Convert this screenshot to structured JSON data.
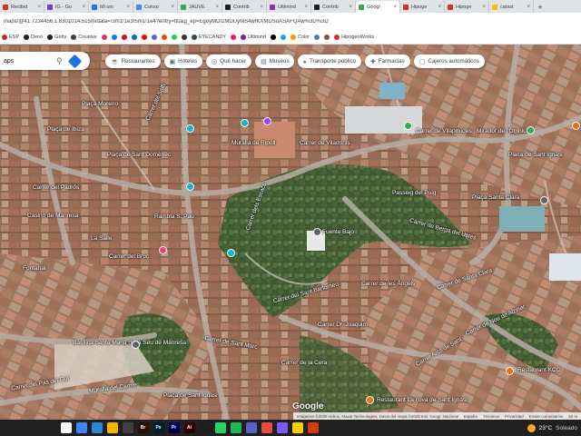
{
  "browser": {
    "tabs": [
      {
        "label": "Recibid",
        "fav": "#d93025"
      },
      {
        "label": "IG - Gu",
        "fav": "#6f42c1"
      },
      {
        "label": "Mi uni",
        "fav": "#1a73e8"
      },
      {
        "label": "Conso",
        "fav": "#4285f4"
      },
      {
        "label": "JAUVE",
        "fav": "#34a853"
      },
      {
        "label": "Contrib",
        "fav": "#202124"
      },
      {
        "label": "Ultimind",
        "fav": "#9c27b0"
      },
      {
        "label": "Contrib",
        "fav": "#202124"
      },
      {
        "label": "Googl",
        "fav": "#34a853",
        "active": true
      },
      {
        "label": "Hipoge",
        "fav": "#d93025"
      },
      {
        "label": "Hipoge",
        "fav": "#d93025"
      },
      {
        "label": "catast",
        "fav": "#fbbc04"
      }
    ],
    "new_tab": "+",
    "url": "maps/@41.7234456,1.8301014,515m/data=!3m1!1e3!5m1!1e4?entry=ttu&g_ep=EgoyMDI1MDUyMS4wIKXMDSoASAFQAw%3D%3D",
    "bookmarks": [
      {
        "label": "ESP",
        "color": "#c62828"
      },
      {
        "label": "Deno",
        "color": "#212121"
      },
      {
        "label": "Getty",
        "color": "#212121"
      },
      {
        "label": "Creative",
        "color": "#424242"
      },
      {
        "label": "",
        "color": "#e1306c"
      },
      {
        "label": "",
        "color": "#1877f2"
      },
      {
        "label": "",
        "color": "#e60023"
      },
      {
        "label": "",
        "color": "#0a66c2"
      },
      {
        "label": "",
        "color": "#ff0000"
      },
      {
        "label": "",
        "color": "#5865f2"
      },
      {
        "label": "",
        "color": "#ff4500"
      },
      {
        "label": "",
        "color": "#25d366"
      },
      {
        "label": "",
        "color": "#333333"
      },
      {
        "label": "EYECANDY",
        "color": "#37474f"
      },
      {
        "label": "",
        "color": "#e91e63"
      },
      {
        "label": "Ultimind",
        "color": "#7b1fa2"
      },
      {
        "label": "",
        "color": "#000000"
      },
      {
        "label": "",
        "color": "#1da1f2"
      },
      {
        "label": "Color",
        "color": "#ff9800"
      },
      {
        "label": "",
        "color": "#607d8b"
      },
      {
        "label": "",
        "color": "#795548"
      },
      {
        "label": "HipogeoWorks",
        "color": "#d32f2f"
      }
    ]
  },
  "maps": {
    "search_value": "aps",
    "search_icon": "search-icon",
    "directions_icon": "directions-icon",
    "chips": [
      {
        "label": "Restaurantes",
        "glyph": "☕"
      },
      {
        "label": "Hoteles",
        "glyph": "▣"
      },
      {
        "label": "Qué hacer",
        "glyph": "◎"
      },
      {
        "label": "Museos",
        "glyph": "▤"
      },
      {
        "label": "Transporte público",
        "glyph": "▸"
      },
      {
        "label": "Farmacias",
        "glyph": "✚"
      },
      {
        "label": "Cajeros automáticos",
        "glyph": "▢"
      }
    ],
    "labels": {
      "l1": "Plaça Moreno",
      "l2": "Plaça de Ibiza",
      "l3": "Carrer de Vilaproïdes",
      "l4": "Carrer de Viladrinis",
      "l5": "Muralla de Ripoll",
      "l6": "Carrer del Padrós",
      "l7": "Carrer dels Escacs",
      "l8": "Passeig del Puig",
      "l9": "Fuente Bajo",
      "l10": "La Salle",
      "l11": "Rambla S. Pau",
      "l12": "Carrer del Sant Bartomeu",
      "l13": "Carrer de Berga del Ustes",
      "l14": "Basílica Santa Maria de la Seu de Manresa",
      "l15": "Carrer de la Cera",
      "l16": "Plaça de Sant Ignasi",
      "l17": "Restaurant La cova de Sant Ignasi",
      "l18": "Restaurant KCC",
      "l19": "Fontanal",
      "l20": "Muralla del Carme",
      "l21": "Plaça Santa Clara",
      "l22": "Carrer de les Àngels",
      "l23": "Carrer del Salfí",
      "l24": "Casino de Manresa",
      "l25": "Carrer de Santa Clara",
      "l26": "Plaça de Sant Domènec",
      "l27": "Carrer del Pas del Gol",
      "l28": "Carrer de Sant Marc",
      "l29": "Carrer Arcs de Sant",
      "l30": "Mirador de l'Òmnium",
      "l31": "Placa de Sant Ignasi",
      "l32": "Carrer Dr. Joaquim",
      "l33": "Carrer de Nou de Alzinar",
      "l34": "Carrer del Bruc"
    },
    "google_logo": "Google",
    "attribution": [
      "Imágenes ©2025 Airbus, Maxar Technologies, Datos del mapa ©2025 Inst. Geogr. Nacional",
      "España",
      "Términos",
      "Privacidad",
      "Enviar comentarios",
      "50 m"
    ]
  },
  "taskbar": {
    "apps": [
      {
        "label": "",
        "color": "#ffffff"
      },
      {
        "label": "",
        "color": "#3a86ff"
      },
      {
        "label": "",
        "color": "#2b88d8"
      },
      {
        "label": "",
        "color": "#f4b400"
      },
      {
        "label": "",
        "color": "#404040"
      },
      {
        "label": "Br",
        "color": "#2a1000"
      },
      {
        "label": "Ps",
        "color": "#001e36"
      },
      {
        "label": "Pr",
        "color": "#00005b"
      },
      {
        "label": "Ai",
        "color": "#330000"
      },
      {
        "label": "",
        "color": "#1e1e1e"
      },
      {
        "label": "",
        "color": "#25d366"
      },
      {
        "label": "",
        "color": "#1db954"
      },
      {
        "label": "",
        "color": "#5b5fc7"
      },
      {
        "label": "",
        "color": "#e94b3c"
      },
      {
        "label": "",
        "color": "#7a5af8"
      },
      {
        "label": "",
        "color": "#ffcd00"
      },
      {
        "label": "",
        "color": "#d83b01"
      }
    ],
    "weather": "23°C",
    "weather_desc": "Soleado"
  }
}
